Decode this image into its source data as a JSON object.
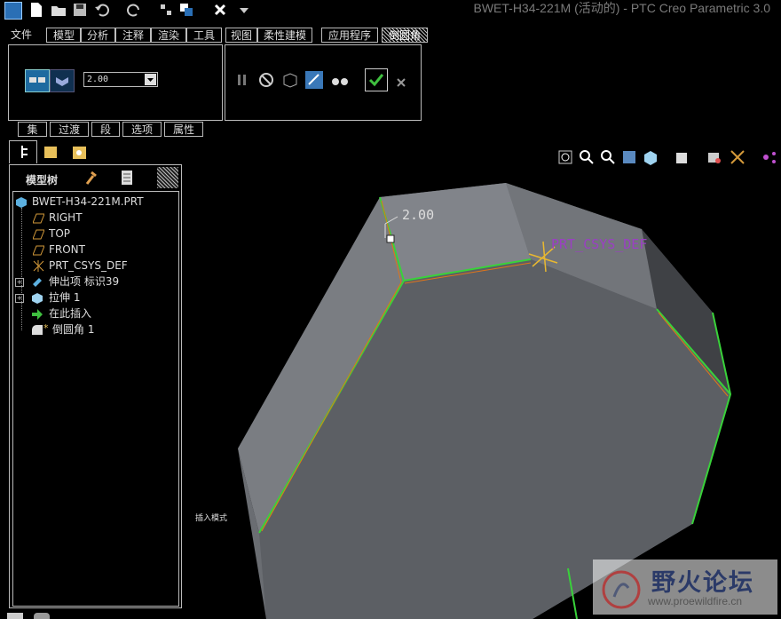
{
  "app": {
    "title": "BWET-H34-221M (活动的) - PTC Creo Parametric 3.0"
  },
  "menu": {
    "items": [
      "文件",
      "模型",
      "分析",
      "注释",
      "渲染",
      "工具",
      "视图",
      "柔性建模",
      "应用程序",
      "倒圆角"
    ]
  },
  "dashboard": {
    "radius_value": "2.00",
    "subtabs": [
      "集",
      "过渡",
      "段",
      "选项",
      "属性"
    ]
  },
  "model_tree": {
    "header": "模型树",
    "items": [
      {
        "label": "BWET-H34-221M.PRT",
        "icon": "part-icon"
      },
      {
        "label": "RIGHT",
        "icon": "datum-plane-icon"
      },
      {
        "label": "TOP",
        "icon": "datum-plane-icon"
      },
      {
        "label": "FRONT",
        "icon": "datum-plane-icon"
      },
      {
        "label": "PRT_CSYS_DEF",
        "icon": "csys-icon"
      },
      {
        "label": "伸出项 标识39",
        "icon": "protrusion-icon"
      },
      {
        "label": "拉伸 1",
        "icon": "extrude-icon"
      },
      {
        "label": "在此插入",
        "icon": "insert-arrow-icon"
      },
      {
        "label": "倒圆角 1",
        "icon": "round-icon"
      }
    ]
  },
  "graphics": {
    "dimension_label": "2.00",
    "csys_label": "PRT_CSYS_DEF",
    "insert_mode_label": "插入模式"
  },
  "watermark": {
    "name": "野火论坛",
    "url": "www.proewildfire.cn"
  },
  "colors": {
    "model_face": "#6a6d72",
    "edge_green": "#39d23a",
    "edge_orange": "#e0751a",
    "csys": "#e8b830",
    "csys_label": "#9b3fc4"
  }
}
